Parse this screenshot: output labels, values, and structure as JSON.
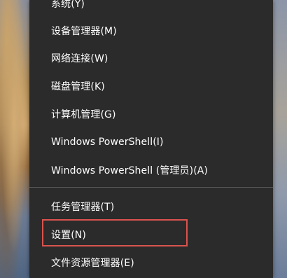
{
  "context_menu": {
    "items": [
      {
        "label": "系统(Y)"
      },
      {
        "label": "设备管理器(M)"
      },
      {
        "label": "网络连接(W)"
      },
      {
        "label": "磁盘管理(K)"
      },
      {
        "label": "计算机管理(G)"
      },
      {
        "label": "Windows PowerShell(I)"
      },
      {
        "label": "Windows PowerShell (管理员)(A)"
      },
      {
        "label": "任务管理器(T)"
      },
      {
        "label": "设置(N)"
      },
      {
        "label": "文件资源管理器(E)"
      }
    ],
    "highlighted_item": "设置(N)",
    "highlight_color": "#d9534f",
    "background_color": "#2b2b2b",
    "text_color": "#ffffff"
  }
}
